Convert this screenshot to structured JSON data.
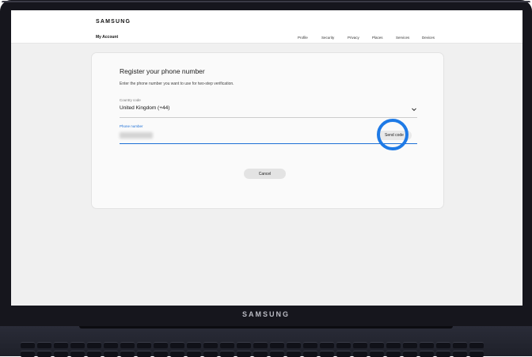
{
  "topbar": {
    "brand": "SAMSUNG",
    "section": "My Account",
    "nav": [
      "Profile",
      "Security",
      "Privacy",
      "Places",
      "Services",
      "Devices"
    ]
  },
  "register": {
    "title": "Register your phone number",
    "description": "Enter the phone number you want to use for two-step verification.",
    "country_code_label": "Country code",
    "country_code_value": "United Kingdom (+44)",
    "phone_label": "Phone number",
    "send_code_label": "Send code",
    "cancel_label": "Cancel"
  },
  "laptop": {
    "logo": "SAMSUNG"
  },
  "colors": {
    "accent": "#1e7ae6",
    "input_active": "#1d6fd6"
  },
  "icons": {
    "dropdown": "chevron-down-icon"
  }
}
